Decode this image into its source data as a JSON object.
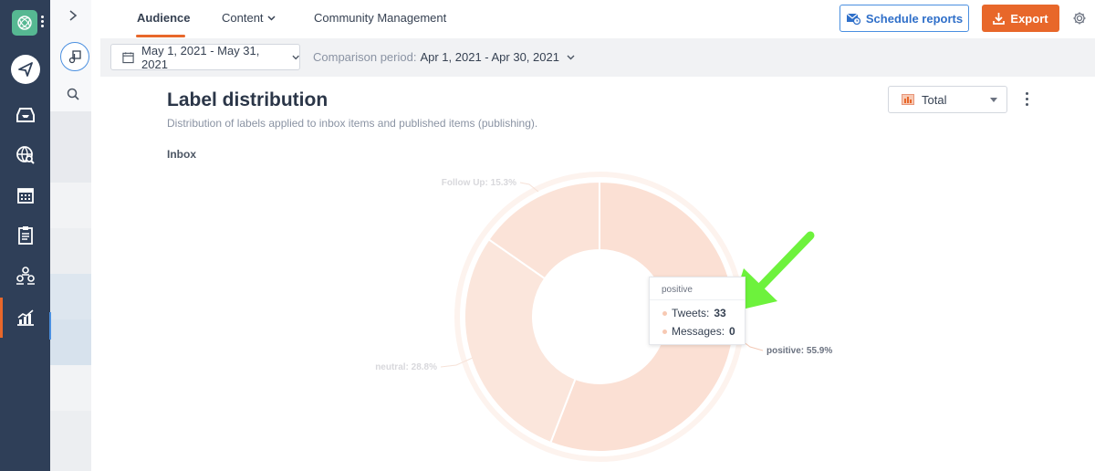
{
  "tabs": {
    "audience": "Audience",
    "content": "Content",
    "community": "Community Management"
  },
  "toolbar": {
    "schedule_label": "Schedule reports",
    "export_label": "Export"
  },
  "filters": {
    "date_range": "May 1, 2021 - May 31, 2021",
    "comparison_label": "Comparison period:",
    "comparison_value": "Apr 1, 2021 - Apr 30, 2021"
  },
  "card": {
    "title": "Label distribution",
    "subtitle": "Distribution of labels applied to inbox items and published items (publishing).",
    "section": "Inbox",
    "view_select": "Total"
  },
  "tooltip": {
    "header": "positive",
    "tweets_label": "Tweets:",
    "tweets_value": "33",
    "messages_label": "Messages:",
    "messages_value": "0"
  },
  "chart_data": {
    "type": "pie",
    "title": "",
    "slices": [
      {
        "label": "positive: 55.9%",
        "name": "positive",
        "value": 55.9,
        "color": "#fbe0d4"
      },
      {
        "label": "neutral: 28.8%",
        "name": "neutral",
        "value": 28.8,
        "color": "#fbe6dc"
      },
      {
        "label": "Follow Up: 15.3%",
        "name": "Follow Up",
        "value": 15.3,
        "color": "#fbe3d8"
      }
    ]
  },
  "colors": {
    "accent": "#e8672a",
    "brand_blue": "#4a8fe0",
    "rail": "#2f3f58",
    "logo": "#56b892",
    "highlight_arrow": "#6df23c"
  },
  "icons": [
    "logo-icon",
    "send-icon",
    "inbox-icon",
    "globe-search-icon",
    "calendar-icon",
    "clipboard-icon",
    "people-icon",
    "analytics-icon",
    "chevron-right-icon",
    "music-note-icon",
    "search-icon",
    "calendar-small-icon",
    "chevron-down-icon",
    "envelope-icon",
    "download-icon",
    "gear-icon",
    "bar-chart-icon",
    "kebab-icon"
  ]
}
